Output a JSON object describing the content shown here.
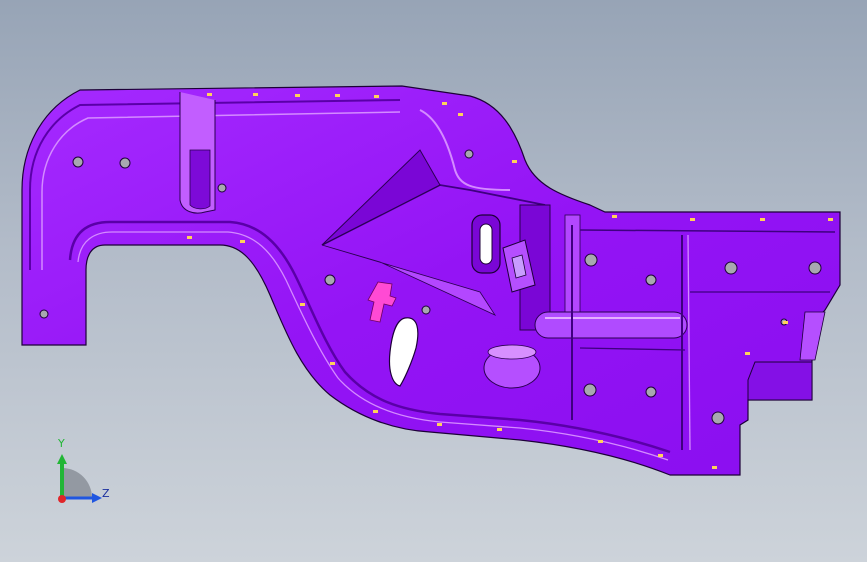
{
  "colors": {
    "part_fill": "#9b1cff",
    "part_light": "#c35bff",
    "part_dark": "#5a00a8",
    "edge": "#1d0038",
    "hole_fill": "#a8a8b0",
    "axis_x": "#e0262a",
    "axis_y": "#22b636",
    "axis_z": "#1f56e0",
    "axis_label": "#1a2e9e"
  },
  "triad": {
    "y_label": "Y",
    "z_label": "Z"
  },
  "icons": [
    "coordinate-triad-icon"
  ]
}
